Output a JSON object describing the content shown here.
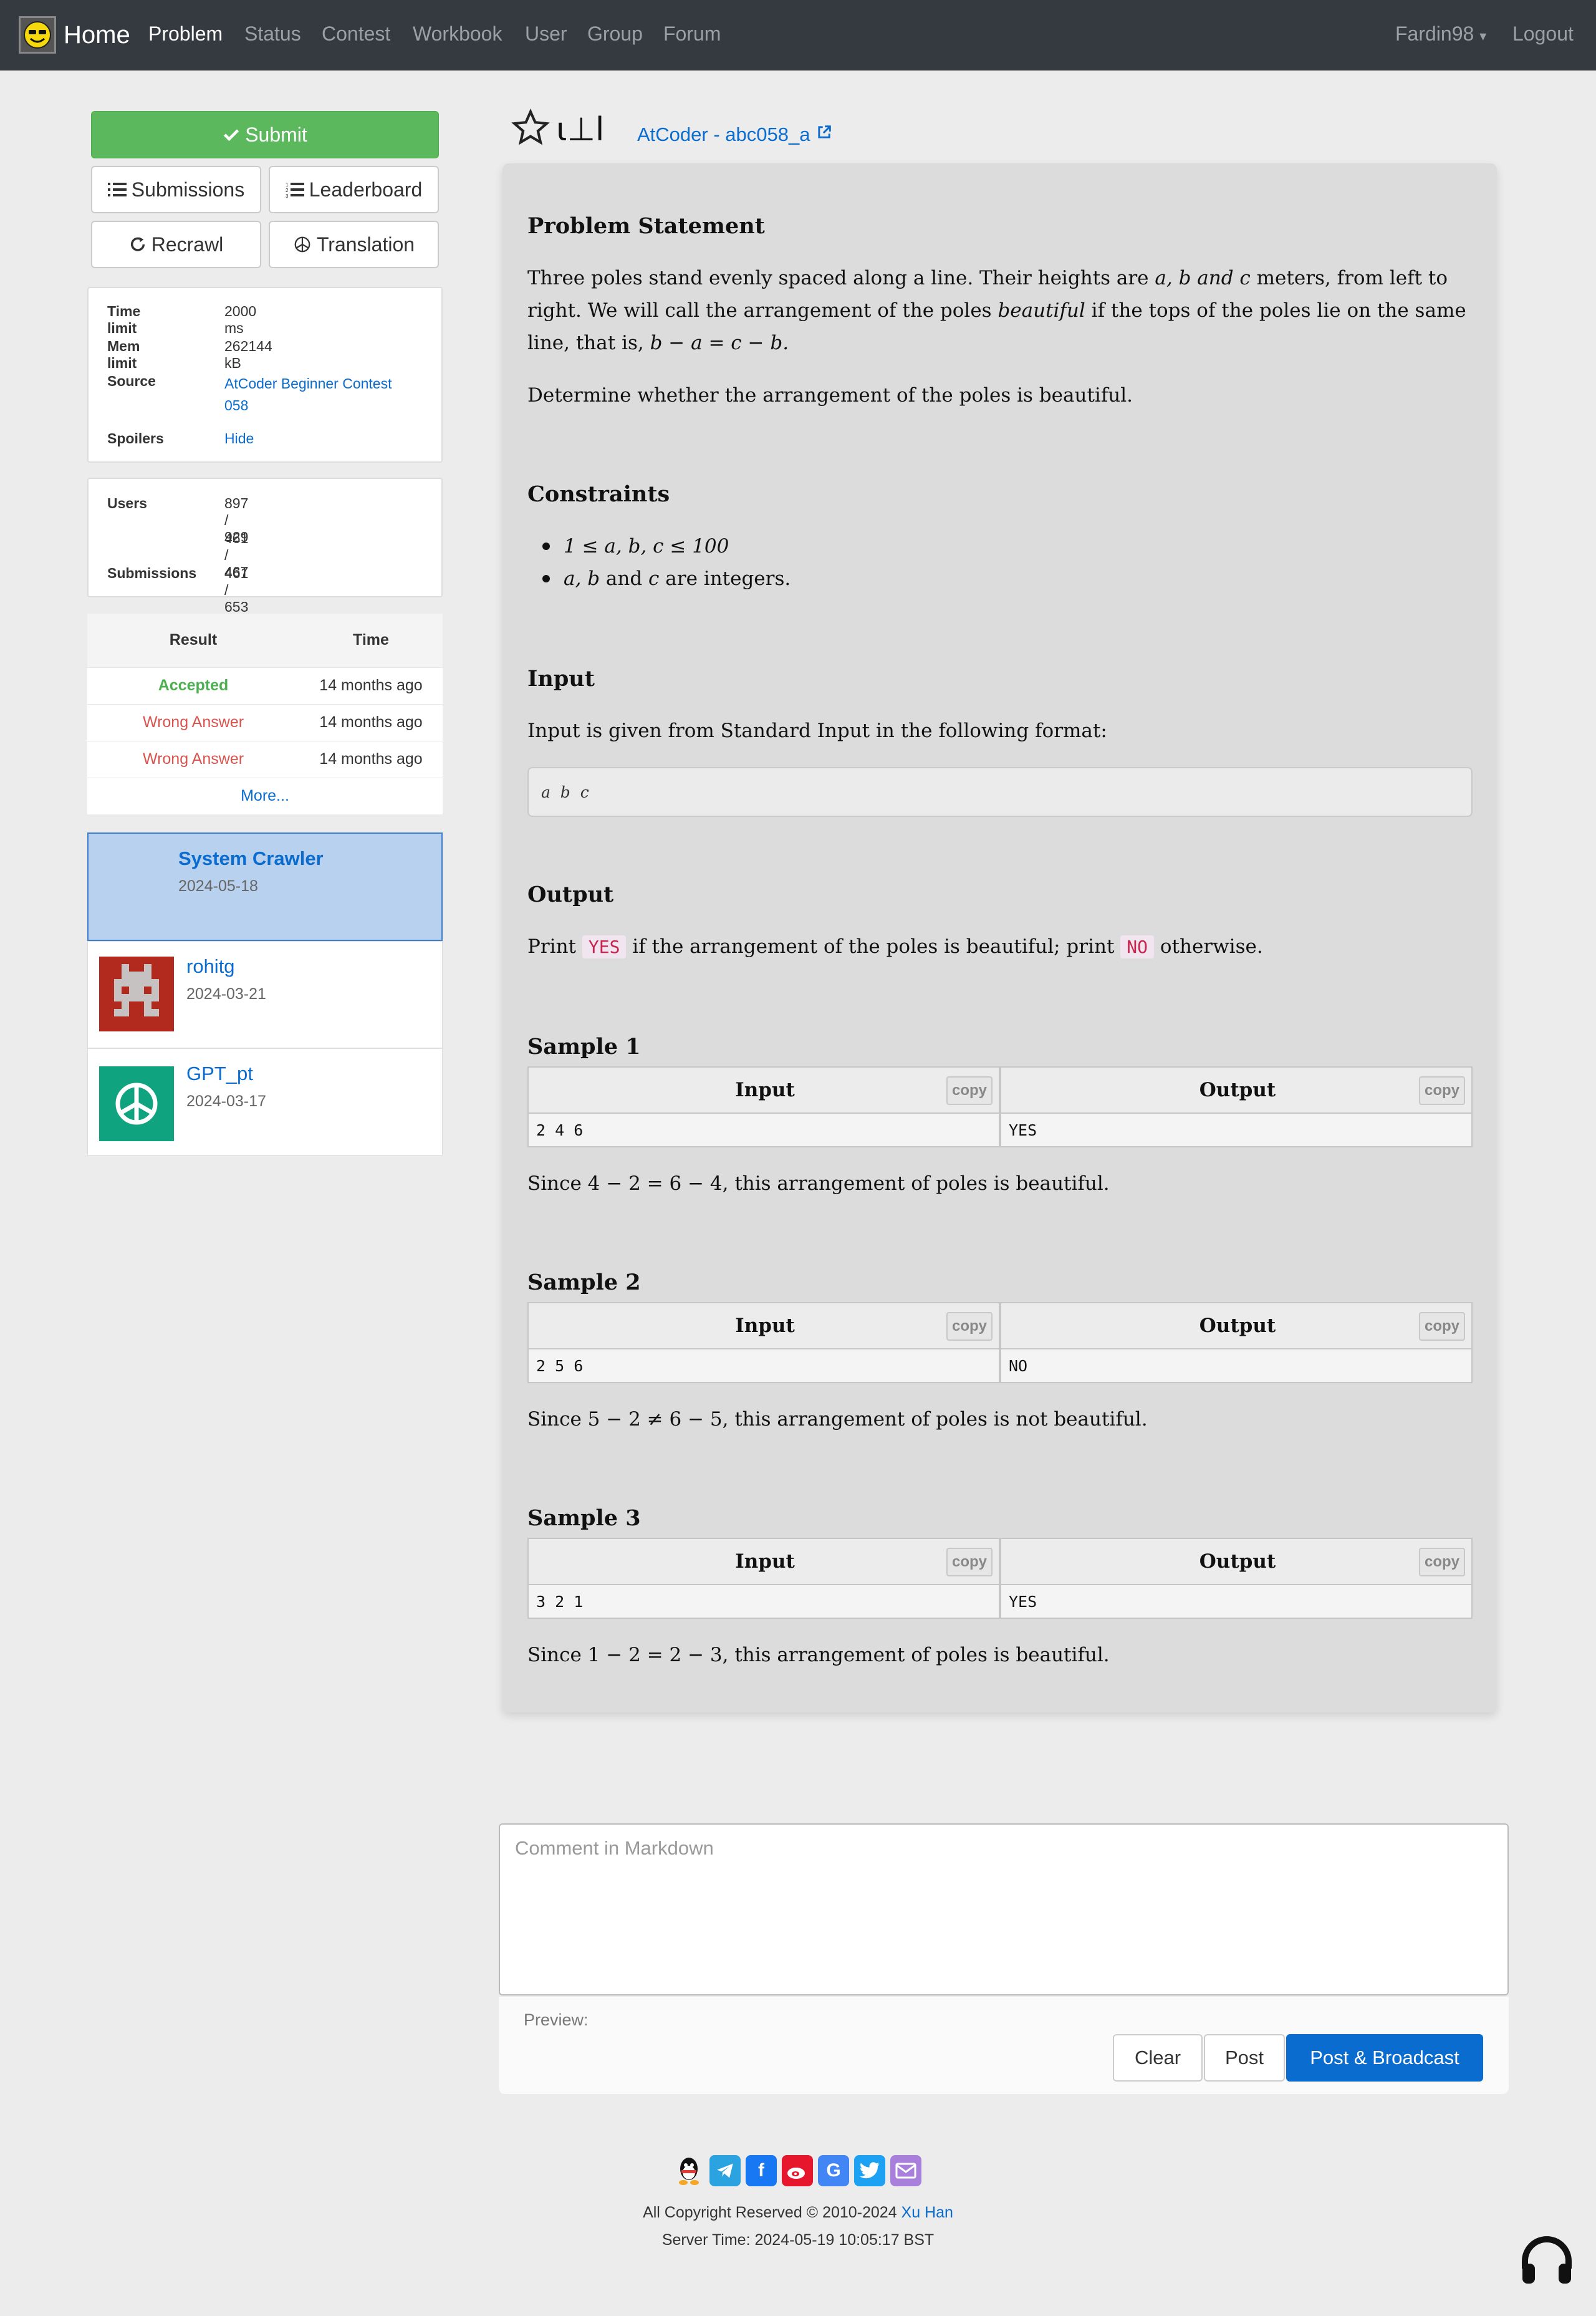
{
  "nav": {
    "brand": "Home",
    "items": [
      "Problem",
      "Status",
      "Contest",
      "Workbook",
      "User",
      "Group",
      "Forum"
    ],
    "user": "Fardin98",
    "logout": "Logout"
  },
  "sidebar": {
    "submit": "Submit",
    "submissions": "Submissions",
    "leaderboard": "Leaderboard",
    "recrawl": "Recrawl",
    "translation": "Translation",
    "info": {
      "time_limit_label": "Time limit",
      "time_limit": "2000 ms",
      "mem_limit_label": "Mem limit",
      "mem_limit": "262144 kB",
      "source_label": "Source",
      "source_line1": "AtCoder Beginner Contest",
      "source_line2": "058",
      "spoilers_label": "Spoilers",
      "spoilers": "Hide"
    },
    "stats": {
      "users_label": "Users",
      "users": "897 / 929",
      "second": "461 / 467",
      "submissions_label": "Submissions",
      "submissions": "461 / 653"
    },
    "results": {
      "head_result": "Result",
      "head_time": "Time",
      "rows": [
        {
          "result": "Accepted",
          "time": "14 months ago"
        },
        {
          "result": "Wrong Answer",
          "time": "14 months ago"
        },
        {
          "result": "Wrong Answer",
          "time": "14 months ago"
        }
      ],
      "more": "More..."
    },
    "solutions": [
      {
        "name": "System Crawler",
        "date": "2024-05-18"
      },
      {
        "name": "rohitg",
        "date": "2024-03-21"
      },
      {
        "name": "GPT_pt",
        "date": "2024-03-17"
      }
    ]
  },
  "problem": {
    "title_glyphs": "ι⊥l",
    "source": "AtCoder - abc058_a",
    "statement_title": "Problem Statement",
    "statement_p1a": "Three poles stand evenly spaced along a line. Their heights are ",
    "statement_p1b": " meters, from left to right. We will call the arrangement of the poles ",
    "statement_beautiful": "beautiful",
    "statement_p1c": " if the tops of the poles lie on the same line, that is, ",
    "statement_vars": "a, b and c",
    "statement_eq": "b − a = c − b.",
    "statement_p2": "Determine whether the arrangement of the poles is beautiful.",
    "constraints_title": "Constraints",
    "constraint1": "1 ≤ a, b, c ≤ 100",
    "constraint2a": "a, b",
    "constraint2b": " and ",
    "constraint2c": "c",
    "constraint2d": " are integers.",
    "input_title": "Input",
    "input_p": "Input is given from Standard Input in the following format:",
    "input_format": "a  b  c",
    "output_title": "Output",
    "output_a": "Print ",
    "output_yes": "YES",
    "output_b": " if the arrangement of the poles is beautiful; print ",
    "output_no": "NO",
    "output_c": " otherwise.",
    "samples": [
      {
        "title": "Sample 1",
        "input": "2 4 6",
        "output": "YES",
        "note": "Since 4 − 2 = 6 − 4, this arrangement of poles is beautiful."
      },
      {
        "title": "Sample 2",
        "input": "2 5 6",
        "output": "NO",
        "note": "Since 5 − 2 ≠ 6 − 5, this arrangement of poles is not beautiful."
      },
      {
        "title": "Sample 3",
        "input": "3 2 1",
        "output": "YES",
        "note": "Since 1 − 2 = 2 − 3, this arrangement of poles is beautiful."
      }
    ],
    "sample_input_head": "Input",
    "sample_output_head": "Output",
    "copy": "copy"
  },
  "comment": {
    "placeholder": "Comment in Markdown",
    "preview": "Preview:",
    "clear": "Clear",
    "post": "Post",
    "post_broadcast": "Post & Broadcast"
  },
  "footer": {
    "copyright_a": "All Copyright Reserved © 2010-2024 ",
    "author": "Xu Han",
    "server_time": "Server Time: 2024-05-19 10:05:17 BST"
  },
  "colors": {
    "accent": "#0a6ccf",
    "success": "#5cb85c",
    "danger": "#d9534f",
    "navbar": "#343a40"
  }
}
